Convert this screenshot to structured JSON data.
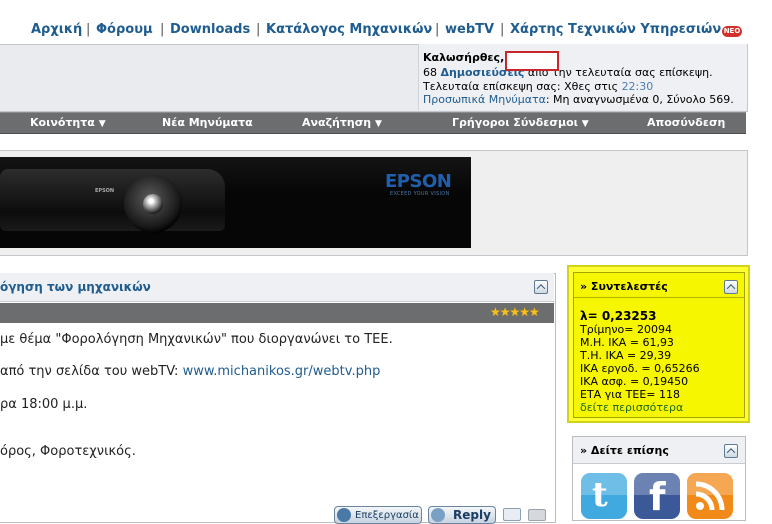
{
  "topnav": {
    "items": [
      "Αρχική",
      "Φόρουμ",
      "Downloads",
      "Κατάλογος Μηχανικών",
      "webTV",
      "Χάρτης Τεχνικών Υπηρεσιών"
    ],
    "separator": "|",
    "new_badge": "NEO"
  },
  "welcome": {
    "greeting": "Καλωσήρθες,",
    "posts_count": "68",
    "posts_link": "Δημοσιεύσεις",
    "posts_suffix": "από την τελευταία σας επίσκεψη.",
    "last_visit_label": "Τελευταία επίσκεψη σας: Χθες στις",
    "last_visit_time": "22:30",
    "pm_link": "Προσωπικά Μηνύματα",
    "pm_status": ": Μη αναγνωσμένα 0, Σύνολο 569."
  },
  "navbar": {
    "items": [
      "Κοινότητα",
      "Νέα Μηνύματα",
      "Αναζήτηση",
      "Γρήγοροι Σύνδεσμοι",
      "Αποσύνδεση"
    ]
  },
  "banner": {
    "brand": "EPSON",
    "slogan": "EXCEED YOUR VISION",
    "device_label": "EPSON"
  },
  "post": {
    "title": "όγηση των μηχανικών",
    "rating_stars": "★★★★★",
    "line1": "με θέμα \"Φορολόγηση Μηχανικών\" που διοργανώνει το ΤΕΕ.",
    "line2_prefix": "από την σελίδα του webTV: ",
    "line2_url": "www.michanikos.gr/webtv.php",
    "line3": "ρα 18:00 μ.μ.",
    "line4": "όρος, Φοροτεχνικός.",
    "edit_label": "Επεξεργασία",
    "reply_label": "Reply"
  },
  "coefficients": {
    "title": "» Συντελεστές",
    "lambda": "λ= 0,23253",
    "rows": [
      "Τρίμηνο= 20094",
      "Μ.Η. ΙΚΑ = 61,93",
      "Τ.Η. ΙΚΑ = 29,39",
      "ΙΚΑ εργοδ. = 0,65266",
      "ΙΚΑ ασφ. = 0,19450",
      "ΕΤΑ για ΤΕΕ= 118"
    ],
    "see_more": "δείτε περισσότερα"
  },
  "see_also": {
    "title": "» Δείτε επίσης"
  },
  "colors": {
    "link": "#1f5c8f",
    "navbar": "#6b6d6f",
    "highlight": "#f6f600",
    "twitter": "#3fa9e0",
    "facebook": "#3b5998",
    "rss": "#f28a1a"
  }
}
